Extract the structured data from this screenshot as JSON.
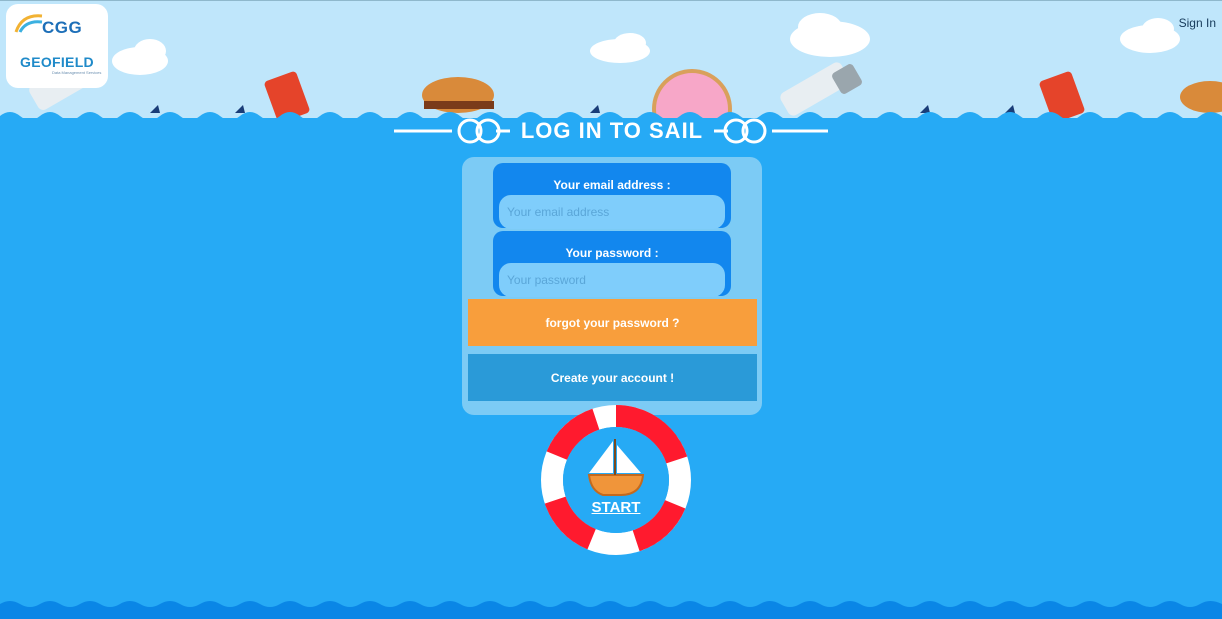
{
  "header": {
    "logo_brand": "CGG",
    "logo_product": "GEOFIELD",
    "logo_tagline": "Data Management Services",
    "sign_in_label": "Sign In"
  },
  "main": {
    "title": "LOG IN TO SAIL",
    "email": {
      "label": "Your email address :",
      "placeholder": "Your email address",
      "value": ""
    },
    "password": {
      "label": "Your password :",
      "placeholder": "Your password",
      "value": ""
    },
    "forgot_label": "forgot your password ?",
    "create_label": "Create your account !",
    "start_label": "START"
  },
  "colors": {
    "sea": "#26aaf5",
    "sky": "#bfe6fb",
    "field_box": "#1287ee",
    "forgot_button": "#f89e3c",
    "create_button": "#2a9ad8",
    "lifebuoy_red": "#ff1a2e"
  },
  "icons": [
    "cgg-logo-icon",
    "geofield-logo-icon",
    "knot-left-icon",
    "knot-right-icon",
    "lifebuoy-icon",
    "sailboat-icon",
    "cloud-icon",
    "burger-icon",
    "donut-icon",
    "soda-can-icon",
    "salt-shaker-icon",
    "shark-fin-icon"
  ]
}
